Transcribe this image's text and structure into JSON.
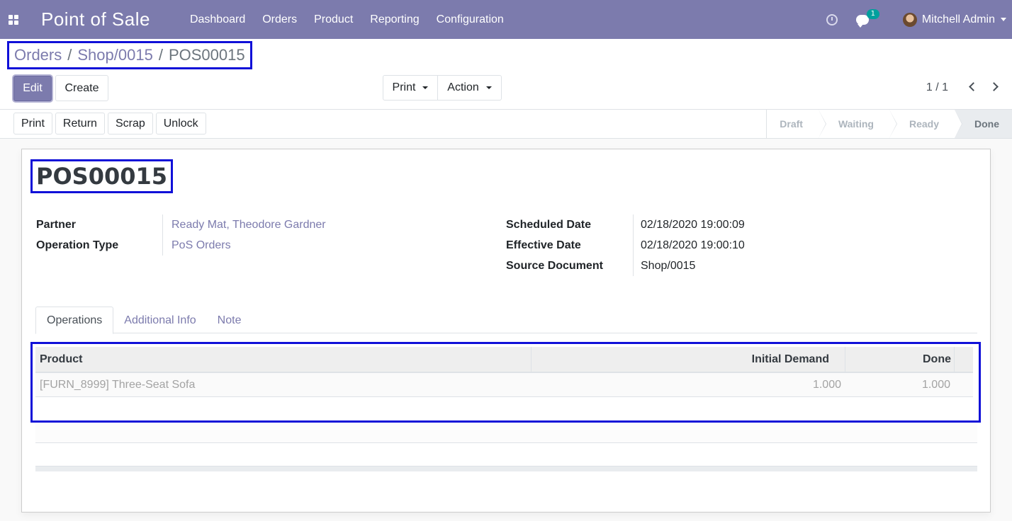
{
  "navbar": {
    "app_title": "Point of Sale",
    "menu": [
      "Dashboard",
      "Orders",
      "Product",
      "Reporting",
      "Configuration"
    ],
    "chat_count": "1",
    "user_name": "Mitchell Admin"
  },
  "breadcrumb": {
    "items": [
      "Orders",
      "Shop/0015"
    ],
    "separator": "/",
    "current": "POS00015"
  },
  "control": {
    "edit_label": "Edit",
    "create_label": "Create",
    "print_label": "Print",
    "action_label": "Action",
    "pager": "1 / 1"
  },
  "status_buttons": [
    "Print",
    "Return",
    "Scrap",
    "Unlock"
  ],
  "stages": [
    "Draft",
    "Waiting",
    "Ready",
    "Done"
  ],
  "active_stage": "Done",
  "record": {
    "title": "POS00015",
    "left_fields": [
      {
        "label": "Partner",
        "value": "Ready Mat, Theodore Gardner"
      },
      {
        "label": "Operation Type",
        "value": "PoS Orders"
      }
    ],
    "right_fields": [
      {
        "label": "Scheduled Date",
        "value": "02/18/2020 19:00:09"
      },
      {
        "label": "Effective Date",
        "value": "02/18/2020 19:00:10"
      },
      {
        "label": "Source Document",
        "value": "Shop/0015"
      }
    ]
  },
  "tabs": [
    "Operations",
    "Additional Info",
    "Note"
  ],
  "operations_table": {
    "columns": [
      "Product",
      "Initial Demand",
      "Done"
    ],
    "rows": [
      {
        "product": "[FURN_8999] Three-Seat Sofa",
        "initial_demand": "1.000",
        "done": "1.000"
      }
    ]
  },
  "colors": {
    "brand": "#7c7bad",
    "highlight_box": "#1010d8",
    "chat_badge": "#00a09d"
  }
}
